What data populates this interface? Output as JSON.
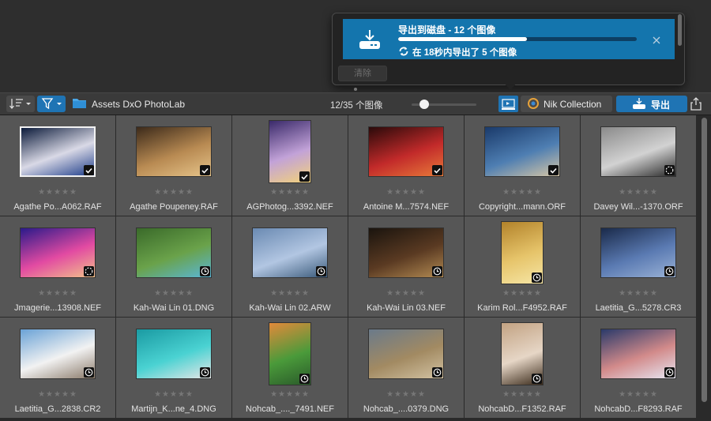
{
  "export_popover": {
    "title": "导出到磁盘 - 12 个图像",
    "status": "在 18秒内导出了 5 个图像",
    "progress": 0.54,
    "clear_label": "清除"
  },
  "toolbar": {
    "folder": "Assets DxO PhotoLab",
    "count": "12/35 个图像",
    "nik_label": "Nik Collection",
    "export_label": "导出"
  },
  "colors": {
    "accent": "#1f74b4",
    "popover_card": "#1475ad"
  },
  "images": [
    {
      "name": "Agathe Po...A062.RAF",
      "badge": "check",
      "selected": true,
      "thumb": "landscape",
      "palette": [
        "#0b1a3a",
        "#d9d9e6",
        "#1f3e8a"
      ]
    },
    {
      "name": "Agathe Poupeney.RAF",
      "badge": "check",
      "selected": false,
      "thumb": "landscape",
      "palette": [
        "#3c2a1a",
        "#b88a52",
        "#e6c48a"
      ]
    },
    {
      "name": "AGPhotog...3392.NEF",
      "badge": "check",
      "selected": false,
      "thumb": "portrait",
      "palette": [
        "#3a2a6a",
        "#c2a2d8",
        "#f2d27a"
      ]
    },
    {
      "name": "Antoine M...7574.NEF",
      "badge": "check",
      "selected": false,
      "thumb": "landscape",
      "palette": [
        "#2a0a0a",
        "#c22a2a",
        "#e87a3a"
      ]
    },
    {
      "name": "Copyright...mann.ORF",
      "badge": "check",
      "selected": false,
      "thumb": "landscape",
      "palette": [
        "#1a3a6a",
        "#4e7eb2",
        "#d6c6a6"
      ]
    },
    {
      "name": "Davey Wil...-1370.ORF",
      "badge": "loading",
      "selected": false,
      "thumb": "landscape",
      "palette": [
        "#8a8a8a",
        "#d2d2d2",
        "#2a2a2a"
      ]
    },
    {
      "name": "Jmagerie...13908.NEF",
      "badge": "loading",
      "selected": false,
      "thumb": "landscape",
      "palette": [
        "#2a1a8a",
        "#e24aa2",
        "#f2c28a"
      ]
    },
    {
      "name": "Kah-Wai Lin 01.DNG",
      "badge": "clock",
      "selected": false,
      "thumb": "landscape",
      "palette": [
        "#3a6a2a",
        "#6aa24a",
        "#5ab6d6"
      ]
    },
    {
      "name": "Kah-Wai Lin 02.ARW",
      "badge": "clock",
      "selected": false,
      "thumb": "landscape",
      "palette": [
        "#6a8ab2",
        "#b2c6e2",
        "#3a5a7a"
      ]
    },
    {
      "name": "Kah-Wai Lin 03.NEF",
      "badge": "clock",
      "selected": false,
      "thumb": "landscape",
      "palette": [
        "#1a140e",
        "#5a3a22",
        "#b28a52"
      ]
    },
    {
      "name": "Karim Rol...F4952.RAF",
      "badge": "clock",
      "selected": false,
      "thumb": "portrait",
      "palette": [
        "#b2822a",
        "#e6c46a",
        "#f6e6a6"
      ]
    },
    {
      "name": "Laetitia_G...5278.CR3",
      "badge": "clock",
      "selected": false,
      "thumb": "landscape",
      "palette": [
        "#1a2a4a",
        "#5a7ab2",
        "#9ab2d6"
      ]
    },
    {
      "name": "Laetitia_G...2838.CR2",
      "badge": "clock",
      "selected": false,
      "thumb": "landscape",
      "palette": [
        "#6aa2d6",
        "#f2f2f2",
        "#8a7a6a"
      ]
    },
    {
      "name": "Martijn_K...ne_4.DNG",
      "badge": "clock",
      "selected": false,
      "thumb": "landscape",
      "palette": [
        "#1a9aa2",
        "#4ad2d2",
        "#e6e6e6"
      ]
    },
    {
      "name": "Nohcab_...._7491.NEF",
      "badge": "clock",
      "selected": false,
      "thumb": "portrait",
      "palette": [
        "#e28a3a",
        "#4a9a3a",
        "#2a5a2a"
      ]
    },
    {
      "name": "Nohcab_....0379.DNG",
      "badge": "clock",
      "selected": false,
      "thumb": "landscape",
      "palette": [
        "#6a7a8a",
        "#a28a62",
        "#d2c2a2"
      ]
    },
    {
      "name": "NohcabD...F1352.RAF",
      "badge": "clock",
      "selected": false,
      "thumb": "portrait",
      "palette": [
        "#c2a282",
        "#e6d6c6",
        "#3a2a1a"
      ]
    },
    {
      "name": "NohcabD...F8293.RAF",
      "badge": "clock",
      "selected": false,
      "thumb": "landscape",
      "palette": [
        "#2a3a6a",
        "#d28a8a",
        "#e6e6f2"
      ]
    }
  ]
}
